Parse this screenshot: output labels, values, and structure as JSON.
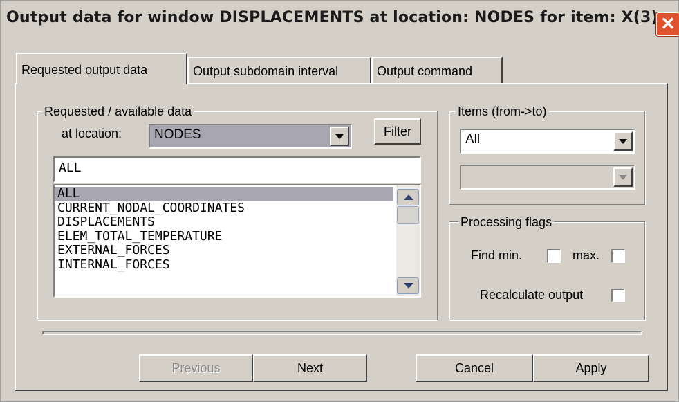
{
  "window": {
    "title": "Output data for window DISPLACEMENTS at location: NODES for item: X(3)",
    "close_glyph": "✕"
  },
  "tabs": [
    {
      "label": "Requested output data",
      "active": true
    },
    {
      "label": "Output subdomain interval",
      "active": false
    },
    {
      "label": "Output command",
      "active": false
    }
  ],
  "requested": {
    "group_label": "Requested / available data",
    "location_label": "at location:",
    "location_value": "NODES",
    "filter_label": "Filter",
    "filter_text": "ALL",
    "list_items": [
      {
        "text": "ALL",
        "selected": true
      },
      {
        "text": "CURRENT_NODAL_COORDINATES",
        "selected": false
      },
      {
        "text": "DISPLACEMENTS",
        "selected": false
      },
      {
        "text": "ELEM_TOTAL_TEMPERATURE",
        "selected": false
      },
      {
        "text": "EXTERNAL_FORCES",
        "selected": false
      },
      {
        "text": "INTERNAL_FORCES",
        "selected": false
      }
    ]
  },
  "items": {
    "group_label": "Items (from->to)",
    "from_value": "All",
    "to_value": ""
  },
  "processing": {
    "group_label": "Processing flags",
    "find_label": "Find  min.",
    "max_label": "max.",
    "recalc_label": "Recalculate output",
    "min_checked": false,
    "max_checked": false,
    "recalc_checked": false
  },
  "buttons": {
    "previous": "Previous",
    "next": "Next",
    "cancel": "Cancel",
    "apply": "Apply"
  },
  "colors": {
    "face": "#d4d0c8",
    "selection": "#a8a6b0",
    "close_button": "#e0522e"
  }
}
